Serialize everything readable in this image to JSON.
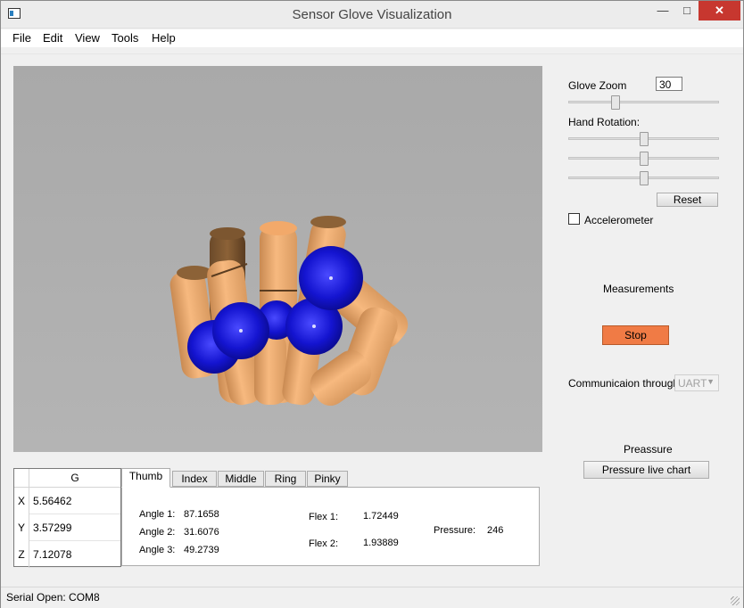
{
  "window": {
    "title": "Sensor Glove Visualization",
    "min_glyph": "—",
    "max_glyph": "□",
    "close_glyph": "✕"
  },
  "menu": [
    "File",
    "Edit",
    "View",
    "Tools",
    "Help"
  ],
  "controls": {
    "glove_zoom_label": "Glove Zoom",
    "glove_zoom_value": "30",
    "glove_zoom_level": 0.3,
    "hand_rotation_label": "Hand Rotation:",
    "rotation_levels": [
      0.5,
      0.5,
      0.5
    ],
    "reset_label": "Reset",
    "accelerometer_label": "Accelerometer",
    "accelerometer_checked": false,
    "measurements_label": "Measurements",
    "stop_label": "Stop",
    "communication_label": "Communicaion through",
    "communication_value": "UART",
    "pressure_section_label": "Preassure",
    "pressure_chart_label": "Pressure live chart"
  },
  "g_table": {
    "header": "G",
    "rows": [
      {
        "axis": "X",
        "value": "5.56462"
      },
      {
        "axis": "Y",
        "value": "3.57299"
      },
      {
        "axis": "Z",
        "value": "7.12078"
      }
    ]
  },
  "tabs": [
    {
      "label": "Thumb",
      "active": true
    },
    {
      "label": "Index",
      "active": false
    },
    {
      "label": "Middle",
      "active": false
    },
    {
      "label": "Ring",
      "active": false
    },
    {
      "label": "Pinky",
      "active": false
    }
  ],
  "finger_data": {
    "angle1_label": "Angle 1:",
    "angle1": "87.1658",
    "angle2_label": "Angle 2:",
    "angle2": "31.6076",
    "angle3_label": "Angle 3:",
    "angle3": "49.2739",
    "flex1_label": "Flex 1:",
    "flex1": "1.72449",
    "flex2_label": "Flex 2:",
    "flex2": "1.93889",
    "pressure_label": "Pressure:",
    "pressure": "246"
  },
  "status": {
    "text": "Serial Open: COM8"
  },
  "colors": {
    "stop_button": "#f07b45",
    "finger_skin": "#f4b27a",
    "sensor_ball": "#1a1ad6",
    "viewport_bg": "#adadad"
  }
}
